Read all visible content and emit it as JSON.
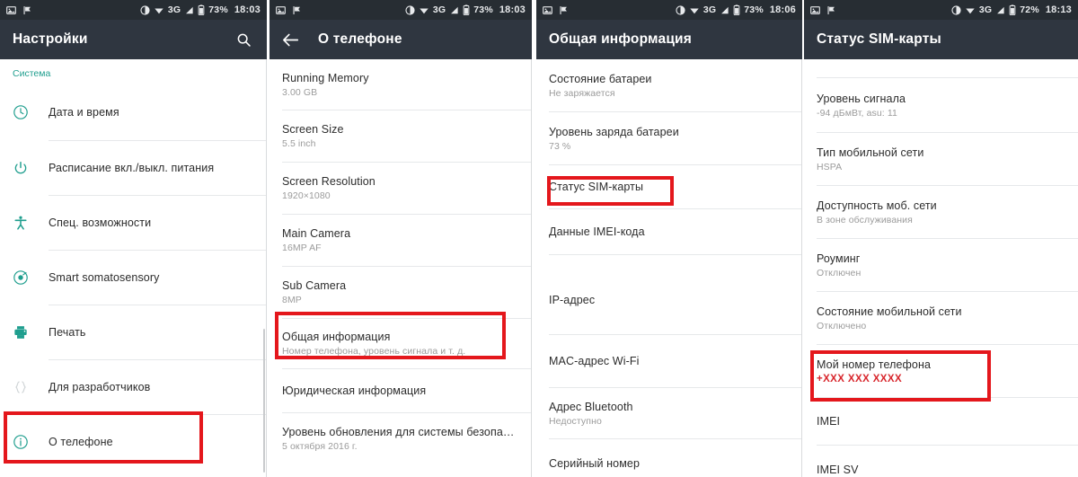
{
  "panels": [
    {
      "id": "settings",
      "statusbar": {
        "left_icons": [
          "image-notification-icon",
          "flag-notification-icon"
        ],
        "dnd_icon": "do-not-disturb-icon",
        "wifi_icon": "wifi-icon",
        "network_text": "3G",
        "signal_icon": "signal-bars-icon",
        "battery_icon": "battery-icon",
        "battery_text": "73%",
        "time": "18:03"
      },
      "appbar": {
        "title": "Настройки",
        "search_icon": "search-icon",
        "back_icon": null
      },
      "section_label": "Система",
      "items": [
        {
          "icon": "clock-icon",
          "label": "Дата и время"
        },
        {
          "icon": "power-icon",
          "label": "Расписание вкл./выкл. питания"
        },
        {
          "icon": "accessibility-icon",
          "label": "Спец. возможности"
        },
        {
          "icon": "somatosensory-icon",
          "label": "Smart somatosensory"
        },
        {
          "icon": "printer-icon",
          "label": "Печать"
        },
        {
          "icon": "braces-icon",
          "label": "Для разработчиков"
        },
        {
          "icon": "info-icon",
          "label": "О телефоне",
          "highlighted": true
        }
      ]
    },
    {
      "id": "about-phone",
      "statusbar": {
        "left_icons": [
          "image-notification-icon",
          "flag-notification-icon"
        ],
        "dnd_icon": "do-not-disturb-icon",
        "wifi_icon": "wifi-icon",
        "network_text": "3G",
        "signal_icon": "signal-bars-icon",
        "battery_icon": "battery-icon",
        "battery_text": "73%",
        "time": "18:03"
      },
      "appbar": {
        "title": "О телефоне",
        "back_icon": "back-arrow-icon",
        "search_icon": null
      },
      "items": [
        {
          "title": "Running Memory",
          "subtitle": "3.00 GB"
        },
        {
          "title": "Screen Size",
          "subtitle": "5.5 inch"
        },
        {
          "title": "Screen Resolution",
          "subtitle": "1920×1080"
        },
        {
          "title": "Main Camera",
          "subtitle": "16MP AF"
        },
        {
          "title": "Sub Camera",
          "subtitle": "8MP"
        },
        {
          "title": "Общая информация",
          "subtitle": "Номер телефона, уровень сигнала и т. д.",
          "highlighted": true
        },
        {
          "title": "Юридическая информация",
          "subtitle": ""
        },
        {
          "title": "Уровень обновления для системы безопа…",
          "subtitle": "5 октября 2016 г."
        }
      ]
    },
    {
      "id": "general-info",
      "statusbar": {
        "left_icons": [
          "image-notification-icon",
          "flag-notification-icon"
        ],
        "dnd_icon": "do-not-disturb-icon",
        "wifi_icon": "wifi-icon",
        "network_text": "3G",
        "signal_icon": "signal-bars-icon",
        "battery_icon": "battery-icon",
        "battery_text": "73%",
        "time": "18:06"
      },
      "appbar": {
        "title": "Общая информация",
        "back_icon": null,
        "search_icon": null
      },
      "items": [
        {
          "title": "Состояние батареи",
          "subtitle": "Не заряжается"
        },
        {
          "title": "Уровень заряда батареи",
          "subtitle": "73 %"
        },
        {
          "title": "Статус SIM-карты",
          "subtitle": "",
          "highlighted": true
        },
        {
          "title": "Данные IMEI-кода",
          "subtitle": ""
        },
        {
          "title": "IP-адрес",
          "subtitle": ""
        },
        {
          "title": "MAC-адрес Wi-Fi",
          "subtitle": ""
        },
        {
          "title": "Адрес Bluetooth",
          "subtitle": "Недоступно"
        },
        {
          "title": "Серийный номер",
          "subtitle": ""
        }
      ]
    },
    {
      "id": "sim-status",
      "statusbar": {
        "left_icons": [
          "image-notification-icon",
          "flag-notification-icon"
        ],
        "dnd_icon": "do-not-disturb-icon",
        "wifi_icon": "wifi-icon",
        "network_text": "3G",
        "signal_icon": "signal-bars-icon",
        "battery_icon": "battery-icon",
        "battery_text": "72%",
        "time": "18:13"
      },
      "appbar": {
        "title": "Статус SIM-карты",
        "back_icon": null,
        "search_icon": null
      },
      "items": [
        {
          "title": "Уровень сигнала",
          "subtitle": "-94 дБмВт, asu: 11"
        },
        {
          "title": "Тип мобильной сети",
          "subtitle": "HSPA"
        },
        {
          "title": "Доступность моб. сети",
          "subtitle": "В зоне обслуживания"
        },
        {
          "title": "Роуминг",
          "subtitle": "Отключен"
        },
        {
          "title": "Состояние мобильной сети",
          "subtitle": "Отключено"
        },
        {
          "title": "Мой номер телефона",
          "subtitle": "+XXX XXX XXXX",
          "subtitle_red": true,
          "highlighted": true
        },
        {
          "title": "IMEI",
          "subtitle": ""
        },
        {
          "title": "IMEI SV",
          "subtitle": ""
        }
      ]
    }
  ],
  "colors": {
    "statusbar_bg": "#272d33",
    "appbar_bg": "#2f3640",
    "accent_teal": "#1f9e8e",
    "highlight_red": "#e4171c",
    "value_red": "#d8262c",
    "title_text": "#2c2c2c",
    "subtitle_text": "#9b9b9b"
  }
}
